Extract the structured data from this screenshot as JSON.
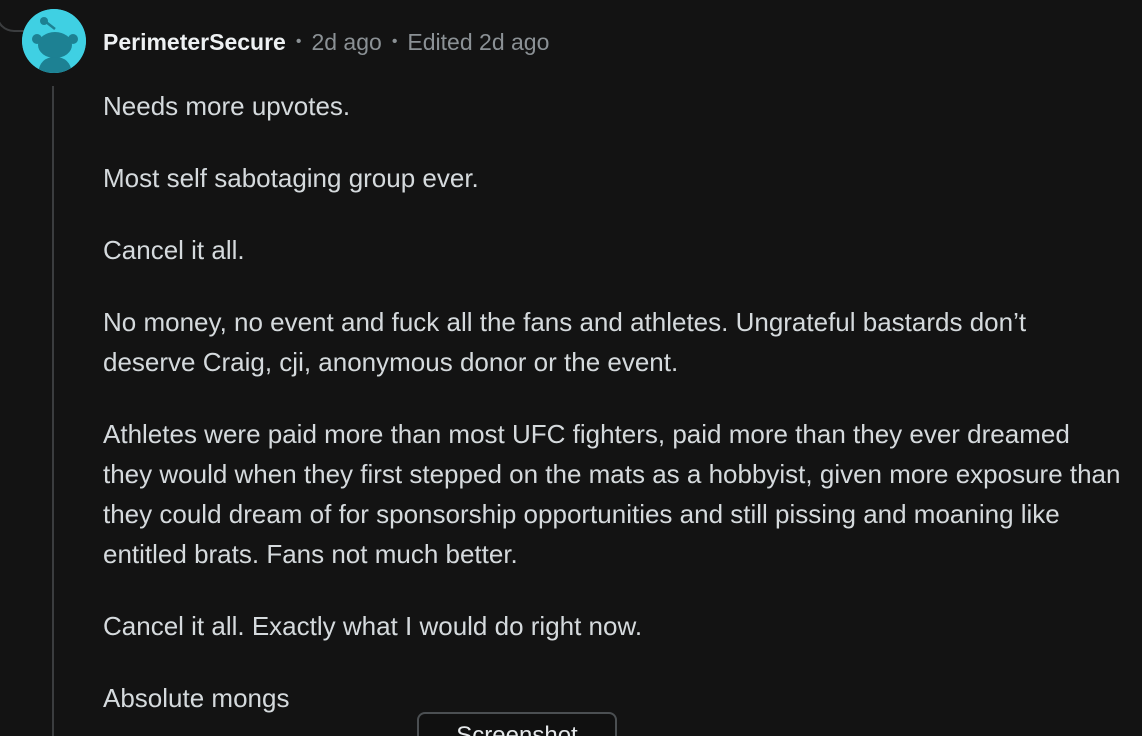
{
  "comment": {
    "username": "PerimeterSecure",
    "posted": "2d ago",
    "edited": "Edited 2d ago",
    "avatar_icon": "snoo-avatar-icon",
    "avatar_color": "#3fd0e3",
    "paragraphs": [
      "Needs more upvotes.",
      "Most self sabotaging group ever.",
      "Cancel it all.",
      "No money, no event and fuck all the fans and athletes. Ungrateful bastards don’t deserve Craig, cji, anonymous donor or the event.",
      "Athletes were paid more than most UFC fighters, paid more than they ever dreamed they would when they first stepped on the mats as a hobbyist, given more exposure than they could dream of for sponsorship opportunities and still pissing and moaning like entitled brats. Fans not much better.",
      "Cancel it all. Exactly what I would do right now.",
      "Absolute mongs"
    ]
  },
  "toast": {
    "label": "Screenshot"
  },
  "separator": "•"
}
